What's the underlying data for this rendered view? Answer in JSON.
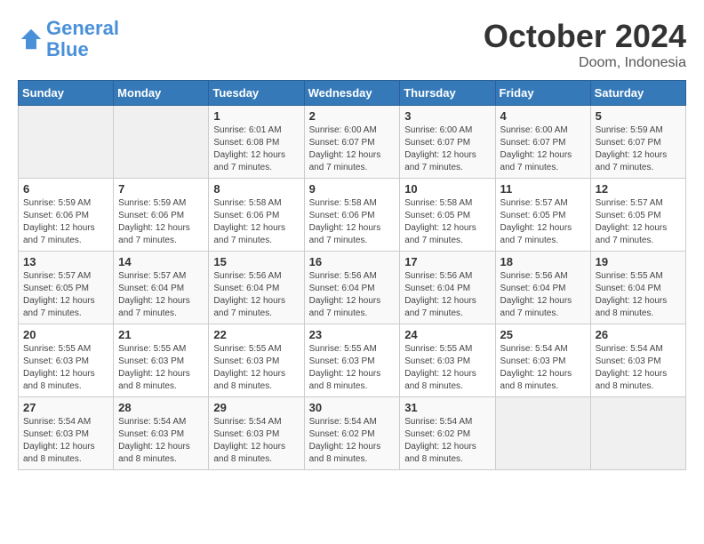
{
  "header": {
    "logo_line1": "General",
    "logo_line2": "Blue",
    "title": "October 2024",
    "location": "Doom, Indonesia"
  },
  "weekdays": [
    "Sunday",
    "Monday",
    "Tuesday",
    "Wednesday",
    "Thursday",
    "Friday",
    "Saturday"
  ],
  "weeks": [
    [
      {
        "day": "",
        "info": ""
      },
      {
        "day": "",
        "info": ""
      },
      {
        "day": "1",
        "info": "Sunrise: 6:01 AM\nSunset: 6:08 PM\nDaylight: 12 hours\nand 7 minutes."
      },
      {
        "day": "2",
        "info": "Sunrise: 6:00 AM\nSunset: 6:07 PM\nDaylight: 12 hours\nand 7 minutes."
      },
      {
        "day": "3",
        "info": "Sunrise: 6:00 AM\nSunset: 6:07 PM\nDaylight: 12 hours\nand 7 minutes."
      },
      {
        "day": "4",
        "info": "Sunrise: 6:00 AM\nSunset: 6:07 PM\nDaylight: 12 hours\nand 7 minutes."
      },
      {
        "day": "5",
        "info": "Sunrise: 5:59 AM\nSunset: 6:07 PM\nDaylight: 12 hours\nand 7 minutes."
      }
    ],
    [
      {
        "day": "6",
        "info": "Sunrise: 5:59 AM\nSunset: 6:06 PM\nDaylight: 12 hours\nand 7 minutes."
      },
      {
        "day": "7",
        "info": "Sunrise: 5:59 AM\nSunset: 6:06 PM\nDaylight: 12 hours\nand 7 minutes."
      },
      {
        "day": "8",
        "info": "Sunrise: 5:58 AM\nSunset: 6:06 PM\nDaylight: 12 hours\nand 7 minutes."
      },
      {
        "day": "9",
        "info": "Sunrise: 5:58 AM\nSunset: 6:06 PM\nDaylight: 12 hours\nand 7 minutes."
      },
      {
        "day": "10",
        "info": "Sunrise: 5:58 AM\nSunset: 6:05 PM\nDaylight: 12 hours\nand 7 minutes."
      },
      {
        "day": "11",
        "info": "Sunrise: 5:57 AM\nSunset: 6:05 PM\nDaylight: 12 hours\nand 7 minutes."
      },
      {
        "day": "12",
        "info": "Sunrise: 5:57 AM\nSunset: 6:05 PM\nDaylight: 12 hours\nand 7 minutes."
      }
    ],
    [
      {
        "day": "13",
        "info": "Sunrise: 5:57 AM\nSunset: 6:05 PM\nDaylight: 12 hours\nand 7 minutes."
      },
      {
        "day": "14",
        "info": "Sunrise: 5:57 AM\nSunset: 6:04 PM\nDaylight: 12 hours\nand 7 minutes."
      },
      {
        "day": "15",
        "info": "Sunrise: 5:56 AM\nSunset: 6:04 PM\nDaylight: 12 hours\nand 7 minutes."
      },
      {
        "day": "16",
        "info": "Sunrise: 5:56 AM\nSunset: 6:04 PM\nDaylight: 12 hours\nand 7 minutes."
      },
      {
        "day": "17",
        "info": "Sunrise: 5:56 AM\nSunset: 6:04 PM\nDaylight: 12 hours\nand 7 minutes."
      },
      {
        "day": "18",
        "info": "Sunrise: 5:56 AM\nSunset: 6:04 PM\nDaylight: 12 hours\nand 7 minutes."
      },
      {
        "day": "19",
        "info": "Sunrise: 5:55 AM\nSunset: 6:04 PM\nDaylight: 12 hours\nand 8 minutes."
      }
    ],
    [
      {
        "day": "20",
        "info": "Sunrise: 5:55 AM\nSunset: 6:03 PM\nDaylight: 12 hours\nand 8 minutes."
      },
      {
        "day": "21",
        "info": "Sunrise: 5:55 AM\nSunset: 6:03 PM\nDaylight: 12 hours\nand 8 minutes."
      },
      {
        "day": "22",
        "info": "Sunrise: 5:55 AM\nSunset: 6:03 PM\nDaylight: 12 hours\nand 8 minutes."
      },
      {
        "day": "23",
        "info": "Sunrise: 5:55 AM\nSunset: 6:03 PM\nDaylight: 12 hours\nand 8 minutes."
      },
      {
        "day": "24",
        "info": "Sunrise: 5:55 AM\nSunset: 6:03 PM\nDaylight: 12 hours\nand 8 minutes."
      },
      {
        "day": "25",
        "info": "Sunrise: 5:54 AM\nSunset: 6:03 PM\nDaylight: 12 hours\nand 8 minutes."
      },
      {
        "day": "26",
        "info": "Sunrise: 5:54 AM\nSunset: 6:03 PM\nDaylight: 12 hours\nand 8 minutes."
      }
    ],
    [
      {
        "day": "27",
        "info": "Sunrise: 5:54 AM\nSunset: 6:03 PM\nDaylight: 12 hours\nand 8 minutes."
      },
      {
        "day": "28",
        "info": "Sunrise: 5:54 AM\nSunset: 6:03 PM\nDaylight: 12 hours\nand 8 minutes."
      },
      {
        "day": "29",
        "info": "Sunrise: 5:54 AM\nSunset: 6:03 PM\nDaylight: 12 hours\nand 8 minutes."
      },
      {
        "day": "30",
        "info": "Sunrise: 5:54 AM\nSunset: 6:02 PM\nDaylight: 12 hours\nand 8 minutes."
      },
      {
        "day": "31",
        "info": "Sunrise: 5:54 AM\nSunset: 6:02 PM\nDaylight: 12 hours\nand 8 minutes."
      },
      {
        "day": "",
        "info": ""
      },
      {
        "day": "",
        "info": ""
      }
    ]
  ]
}
